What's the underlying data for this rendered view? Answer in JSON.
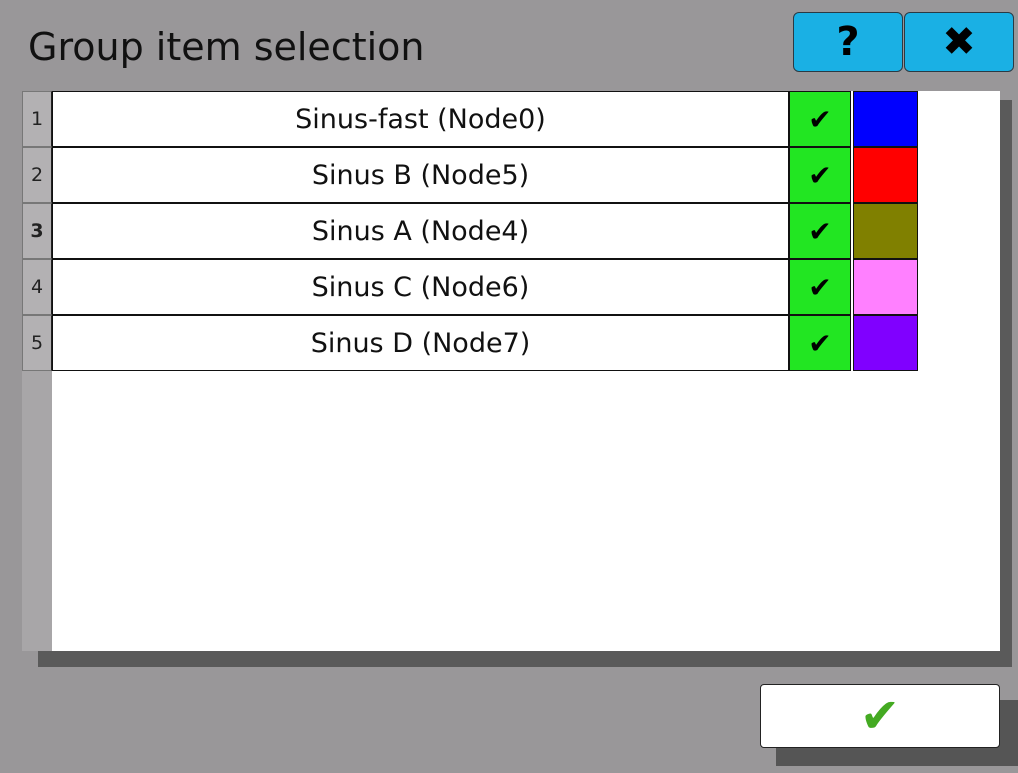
{
  "dialog": {
    "title": "Group item selection",
    "help_label": "?",
    "close_label": "✖"
  },
  "rows": [
    {
      "index": "1",
      "label": "Sinus-fast (Node0)",
      "checked": true,
      "check_glyph": "✔",
      "color": "#0000ff"
    },
    {
      "index": "2",
      "label": "Sinus B (Node5)",
      "checked": true,
      "check_glyph": "✔",
      "color": "#ff0000"
    },
    {
      "index": "3",
      "label": "Sinus A (Node4)",
      "checked": true,
      "check_glyph": "✔",
      "color": "#808000"
    },
    {
      "index": "4",
      "label": "Sinus C (Node6)",
      "checked": true,
      "check_glyph": "✔",
      "color": "#ff80ff"
    },
    {
      "index": "5",
      "label": "Sinus D (Node7)",
      "checked": true,
      "check_glyph": "✔",
      "color": "#8000ff"
    }
  ],
  "colors": {
    "dialog_background": "#999799",
    "header_button": "#1ab0e4",
    "check_cell": "#22e622",
    "ok_icon": "#44aa22"
  },
  "footer": {
    "ok_icon": "confirm-check-icon",
    "ok_glyph": "✔"
  }
}
